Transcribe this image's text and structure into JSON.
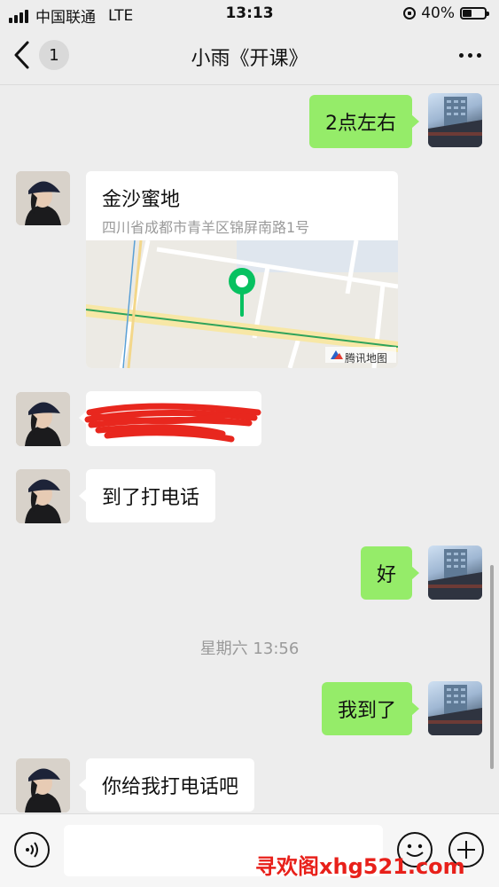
{
  "status_bar": {
    "carrier": "中国联通",
    "network": "LTE",
    "time": "13:13",
    "battery": "40%",
    "battery_level": 0.4
  },
  "nav": {
    "unread_count": "1",
    "title": "小雨《开课》",
    "back_icon": "chevron-left-icon",
    "more_icon": "more-dots-icon"
  },
  "messages": [
    {
      "side": "right",
      "text": "2点左右"
    },
    {
      "side": "left",
      "type": "location",
      "title": "金沙蜜地",
      "address": "四川省成都市青羊区锦屏南路1号",
      "map_provider": "腾讯地图"
    },
    {
      "side": "left",
      "type": "redacted"
    },
    {
      "side": "left",
      "text": "到了打电话"
    },
    {
      "side": "right",
      "text": "好"
    },
    {
      "side": "right",
      "text": "我到了"
    },
    {
      "side": "left",
      "text": "你给我打电话吧"
    }
  ],
  "timestamp": "星期六 13:56",
  "input_bar": {
    "voice_icon": "voice-icon",
    "emoji_icon": "emoji-icon",
    "plus_icon": "plus-icon"
  },
  "watermark": "寻欢阁xhg521.com",
  "colors": {
    "green_bubble": "#95ec69",
    "white_bubble": "#ffffff",
    "background": "#ededed",
    "map_pin": "#07c160",
    "redaction": "#e8271e",
    "watermark": "#e8201a"
  }
}
